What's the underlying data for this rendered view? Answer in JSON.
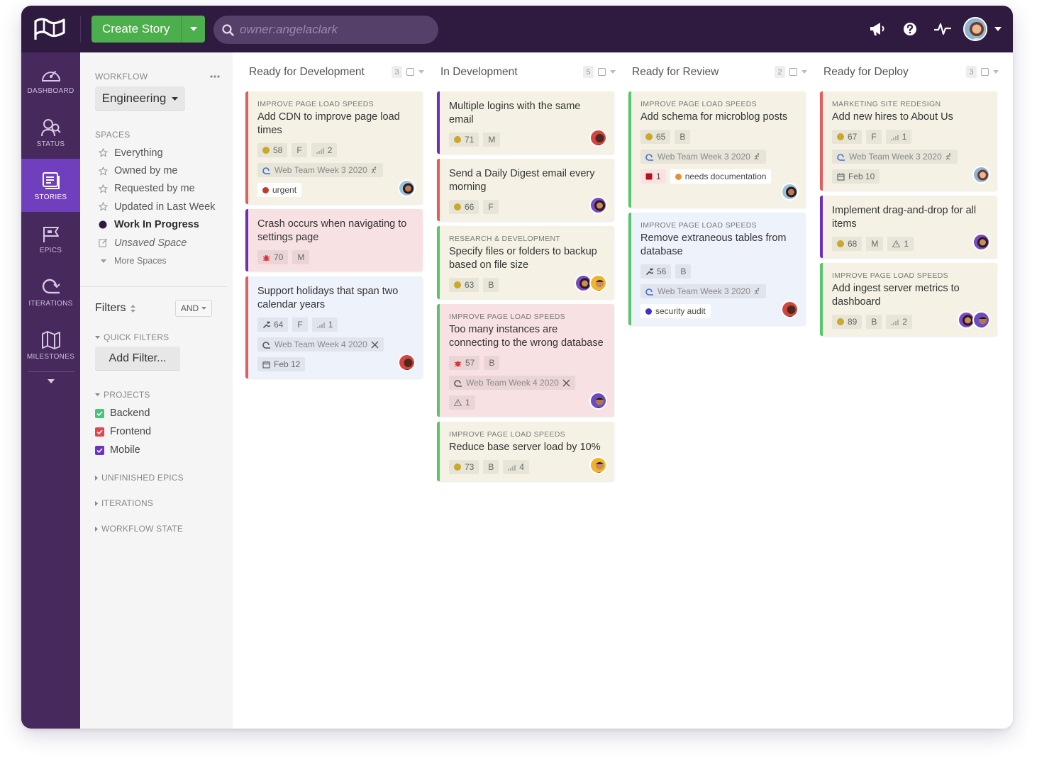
{
  "header": {
    "create_label": "Create Story",
    "search_placeholder": "owner:angelaclark",
    "icons": [
      "megaphone-icon",
      "help-icon",
      "activity-icon",
      "avatar",
      "chevron-down-icon"
    ]
  },
  "nav": {
    "items": [
      {
        "label": "DASHBOARD",
        "icon": "dashboard-icon"
      },
      {
        "label": "STATUS",
        "icon": "status-icon"
      },
      {
        "label": "STORIES",
        "icon": "stories-icon",
        "active": true
      },
      {
        "label": "EPICS",
        "icon": "epics-icon"
      },
      {
        "label": "ITERATIONS",
        "icon": "iterations-icon"
      },
      {
        "label": "MILESTONES",
        "icon": "milestones-icon"
      }
    ]
  },
  "panel": {
    "workflow_label": "WORKFLOW",
    "workflow_value": "Engineering",
    "spaces_label": "SPACES",
    "spaces": [
      "Everything",
      "Owned by me",
      "Requested by me",
      "Updated in Last Week",
      "Work In Progress",
      "Unsaved Space",
      "More Spaces"
    ],
    "filters_label": "Filters",
    "and_value": "AND",
    "quick_filters": "QUICK FILTERS",
    "add_filter": "Add Filter...",
    "projects_label": "PROJECTS",
    "projects": [
      {
        "name": "Backend",
        "color": "#4bc27c"
      },
      {
        "name": "Frontend",
        "color": "#e0474c"
      },
      {
        "name": "Mobile",
        "color": "#6a34c2"
      }
    ],
    "unfinished_epics": "UNFINISHED EPICS",
    "iterations": "ITERATIONS",
    "workflow_state": "WORKFLOW STATE"
  },
  "columns": [
    {
      "title": "Ready for Development",
      "count": "3",
      "cards": [
        {
          "epic": "IMPROVE PAGE LOAD SPEEDS",
          "title": "Add CDN to improve page load times",
          "estimate": "58",
          "size": "F",
          "priority": "2",
          "iteration": "Web Team Week 3 2020",
          "label": "urgent"
        },
        {
          "title": "Crash occurs when navigating to settings page",
          "estimate": "70",
          "size": "M"
        },
        {
          "title": "Support holidays that span two calendar years",
          "estimate": "64",
          "size": "F",
          "priority": "1",
          "iteration": "Web Team Week 4 2020",
          "due": "Feb 12"
        }
      ]
    },
    {
      "title": "In Development",
      "count": "5",
      "cards": [
        {
          "title": "Multiple logins with the same email",
          "estimate": "71",
          "size": "M"
        },
        {
          "title": "Send a Daily Digest email every morning",
          "estimate": "66",
          "size": "F"
        },
        {
          "epic": "RESEARCH & DEVELOPMENT",
          "title": "Specify files or folders to backup based on file size",
          "estimate": "63",
          "size": "B"
        },
        {
          "epic": "IMPROVE PAGE LOAD SPEEDS",
          "title": "Too many instances are connecting to the wrong database",
          "estimate": "57",
          "size": "B",
          "iteration": "Web Team Week 4 2020",
          "blockers": "1"
        },
        {
          "epic": "IMPROVE PAGE LOAD SPEEDS",
          "title": "Reduce base server load by 10%",
          "estimate": "73",
          "size": "B",
          "priority": "4"
        }
      ]
    },
    {
      "title": "Ready for Review",
      "count": "2",
      "cards": [
        {
          "epic": "IMPROVE PAGE LOAD SPEEDS",
          "title": "Add schema for microblog posts",
          "estimate": "65",
          "size": "B",
          "iteration": "Web Team Week 3 2020",
          "tasks": "1",
          "label": "needs documentation"
        },
        {
          "epic": "IMPROVE PAGE LOAD SPEEDS",
          "title": "Remove extraneous tables from database",
          "estimate": "56",
          "size": "B",
          "iteration": "Web Team Week 3 2020",
          "label": "security audit"
        }
      ]
    },
    {
      "title": "Ready for Deploy",
      "count": "3",
      "cards": [
        {
          "epic": "MARKETING SITE REDESIGN",
          "title": "Add new hires to About Us",
          "estimate": "67",
          "size": "F",
          "priority": "1",
          "iteration": "Web Team Week 3 2020",
          "due": "Feb 10"
        },
        {
          "title": "Implement drag-and-drop for all items",
          "estimate": "68",
          "size": "M",
          "blockers": "1"
        },
        {
          "epic": "IMPROVE PAGE LOAD SPEEDS",
          "title": "Add ingest server metrics to dashboard",
          "estimate": "89",
          "size": "B",
          "priority": "2"
        }
      ]
    }
  ]
}
